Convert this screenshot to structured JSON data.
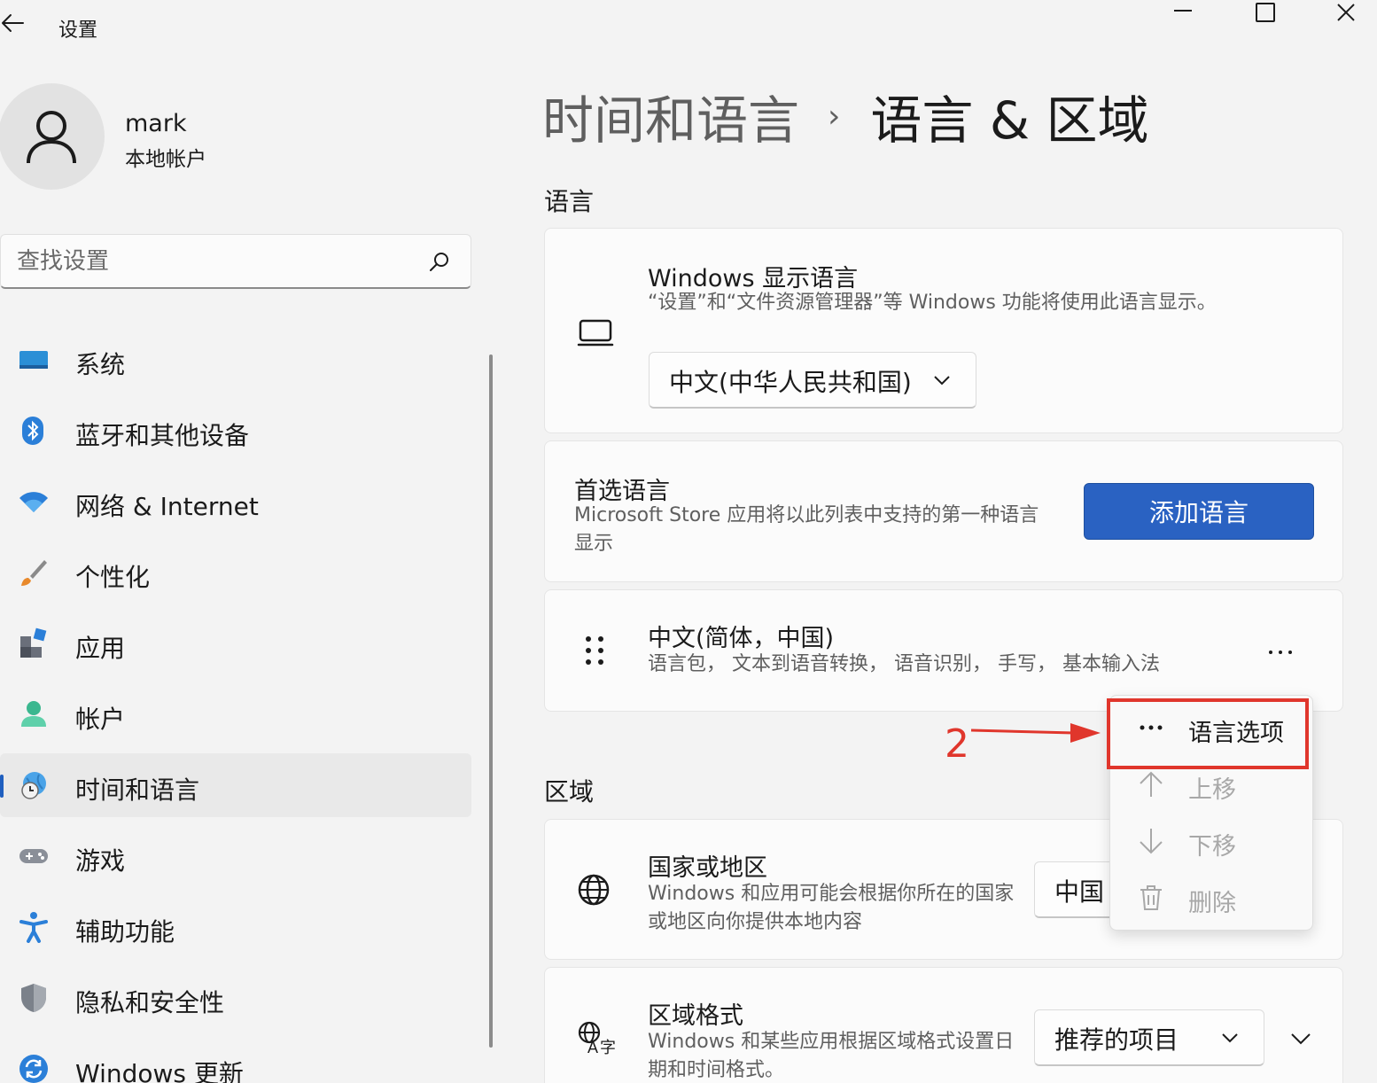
{
  "app": {
    "title": "设置"
  },
  "user": {
    "name": "mark",
    "type": "本地帐户"
  },
  "search": {
    "placeholder": "查找设置"
  },
  "nav": {
    "items": [
      {
        "label": "系统",
        "icon": "display-icon"
      },
      {
        "label": "蓝牙和其他设备",
        "icon": "bluetooth-icon"
      },
      {
        "label": "网络 & Internet",
        "icon": "wifi-icon"
      },
      {
        "label": "个性化",
        "icon": "paintbrush-icon"
      },
      {
        "label": "应用",
        "icon": "apps-icon"
      },
      {
        "label": "帐户",
        "icon": "person-icon"
      },
      {
        "label": "时间和语言",
        "icon": "globe-clock-icon",
        "active": true
      },
      {
        "label": "游戏",
        "icon": "gamepad-icon"
      },
      {
        "label": "辅助功能",
        "icon": "accessibility-icon"
      },
      {
        "label": "隐私和安全性",
        "icon": "shield-icon"
      },
      {
        "label": "Windows 更新",
        "icon": "update-icon"
      }
    ]
  },
  "breadcrumb": {
    "parent": "时间和语言",
    "separator": "›",
    "current": "语言 & 区域"
  },
  "language_section": {
    "title": "语言",
    "display_language": {
      "title": "Windows 显示语言",
      "description": "“设置”和“文件资源管理器”等 Windows 功能将使用此语言显示。",
      "value": "中文(中华人民共和国)"
    },
    "preferred": {
      "title": "首选语言",
      "description": "Microsoft Store 应用将以此列表中支持的第一种语言显示",
      "button": "添加语言"
    },
    "installed": {
      "name": "中文(简体，中国)",
      "features": "语言包，  文本到语音转换，  语音识别，  手写，  基本输入法"
    }
  },
  "context_menu": {
    "items": [
      {
        "label": "语言选项",
        "icon": "more-icon",
        "enabled": true
      },
      {
        "label": "上移",
        "icon": "arrow-up-icon",
        "enabled": false
      },
      {
        "label": "下移",
        "icon": "arrow-down-icon",
        "enabled": false
      },
      {
        "label": "删除",
        "icon": "trash-icon",
        "enabled": false
      }
    ]
  },
  "region_section": {
    "title": "区域",
    "country": {
      "title": "国家或地区",
      "description": "Windows 和应用可能会根据你所在的国家或地区向你提供本地内容",
      "value": "中国"
    },
    "format": {
      "title": "区域格式",
      "description": "Windows 和某些应用根据区域格式设置日期和时间格式。",
      "value": "推荐的项目"
    }
  },
  "annotation": {
    "number": "2",
    "color": "#e0362c"
  },
  "colors": {
    "accent": "#2a62c2",
    "annotation": "#e0362c"
  }
}
